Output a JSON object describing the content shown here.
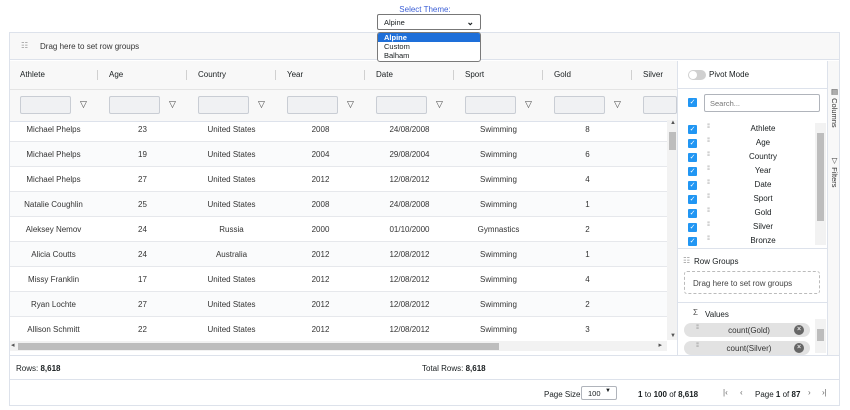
{
  "theme": {
    "label": "Select Theme:",
    "selected": "Alpine",
    "options": [
      "Alpine",
      "Custom",
      "Balham"
    ]
  },
  "row_group_bar": {
    "text": "Drag here to set row groups"
  },
  "columns": [
    "Athlete",
    "Age",
    "Country",
    "Year",
    "Date",
    "Sport",
    "Gold",
    "Silver"
  ],
  "rows": [
    [
      "Michael Phelps",
      "23",
      "United States",
      "2008",
      "24/08/2008",
      "Swimming",
      "8"
    ],
    [
      "Michael Phelps",
      "19",
      "United States",
      "2004",
      "29/08/2004",
      "Swimming",
      "6"
    ],
    [
      "Michael Phelps",
      "27",
      "United States",
      "2012",
      "12/08/2012",
      "Swimming",
      "4"
    ],
    [
      "Natalie Coughlin",
      "25",
      "United States",
      "2008",
      "24/08/2008",
      "Swimming",
      "1"
    ],
    [
      "Aleksey Nemov",
      "24",
      "Russia",
      "2000",
      "01/10/2000",
      "Gymnastics",
      "2"
    ],
    [
      "Alicia Coutts",
      "24",
      "Australia",
      "2012",
      "12/08/2012",
      "Swimming",
      "1"
    ],
    [
      "Missy Franklin",
      "17",
      "United States",
      "2012",
      "12/08/2012",
      "Swimming",
      "4"
    ],
    [
      "Ryan Lochte",
      "27",
      "United States",
      "2012",
      "12/08/2012",
      "Swimming",
      "2"
    ],
    [
      "Allison Schmitt",
      "22",
      "United States",
      "2012",
      "12/08/2012",
      "Swimming",
      "3"
    ]
  ],
  "tool_panel": {
    "pivot_mode": "Pivot Mode",
    "search_placeholder": "Search...",
    "column_list": [
      "Athlete",
      "Age",
      "Country",
      "Year",
      "Date",
      "Sport",
      "Gold",
      "Silver",
      "Bronze"
    ],
    "row_groups_title": "Row Groups",
    "row_groups_drop": "Drag here to set row groups",
    "values_title": "Values",
    "values": [
      "count(Gold)",
      "count(Silver)"
    ],
    "tabs": [
      "Columns",
      "Filters"
    ]
  },
  "status": {
    "rows_label": "Rows:",
    "rows_value": "8,618",
    "total_label": "Total Rows:",
    "total_value": "8,618"
  },
  "paging": {
    "page_size_label": "Page Size:",
    "page_size": "100",
    "from": "1",
    "to_word": "to",
    "to": "100",
    "of_word": "of",
    "total": "8,618",
    "page_word": "Page",
    "page": "1",
    "page_of_word": "of",
    "page_count": "87"
  },
  "icons": {
    "filter": "funnel-icon",
    "checkbox": "check-icon",
    "grip": "drag-grip-icon",
    "sigma": "sigma-icon",
    "row_group": "row-group-icon",
    "nav": [
      "first-page-icon",
      "prev-page-icon",
      "next-page-icon",
      "last-page-icon"
    ]
  },
  "colors": {
    "accent": "#2196f3",
    "link": "#3c5fd6",
    "dropdown_selected": "#1e6fd9"
  }
}
